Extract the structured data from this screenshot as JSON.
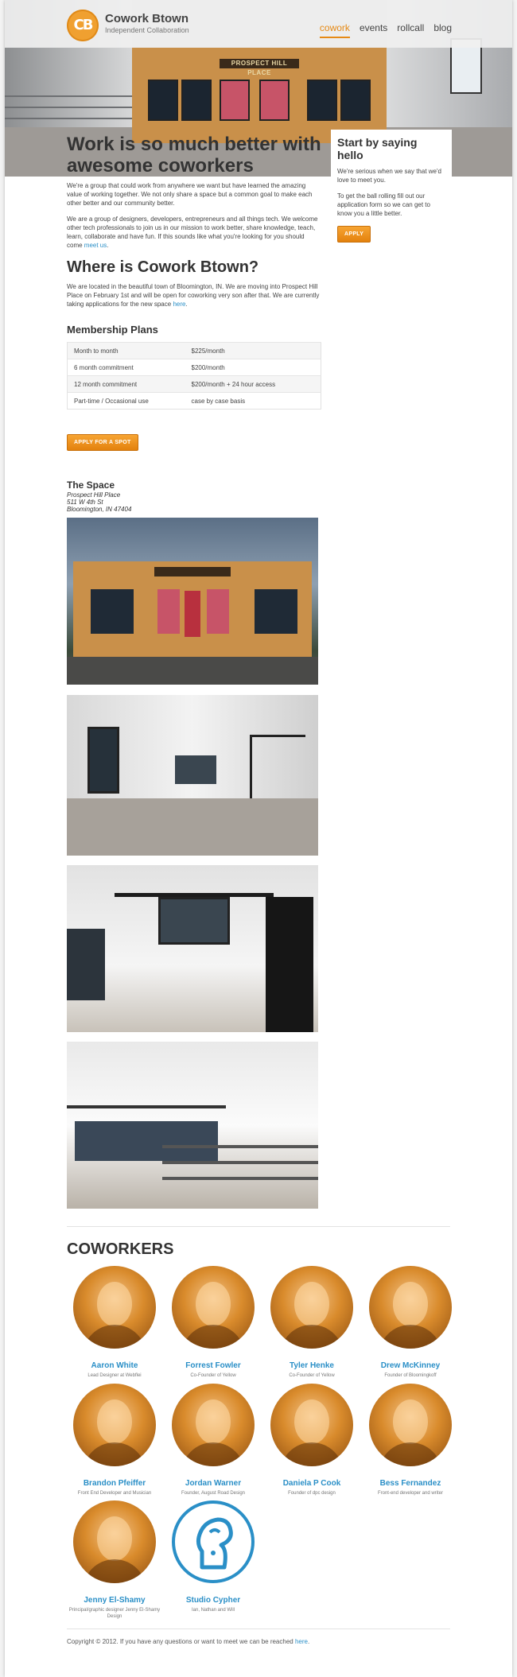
{
  "header": {
    "logo_text": "CB",
    "brand": "Cowork Btown",
    "tagline": "Independent Collaboration",
    "nav": [
      "cowork",
      "events",
      "rollcall",
      "blog"
    ]
  },
  "hero": {
    "sign": "PROSPECT HILL PLACE",
    "heading": "Work is so much better with awesome coworkers"
  },
  "hello": {
    "title": "Start by saying hello",
    "p1": "We're serious when we say that we'd love to meet you.",
    "p2": "To get the ball rolling fill out our application form so we can get to know you a little better.",
    "button": "APPLY"
  },
  "intro": {
    "p1": "We're a group that could work from anywhere we want but have learned the amazing value of working together. We not only share a space but a common goal to make each other better and our community better.",
    "p2": "We are a group of designers, developers, entrepreneurs and all things tech. We welcome other tech professionals to join us in our mission to work better, share knowledge, teach, learn, collaborate and have fun. If this sounds like what you're looking for you should come",
    "p2_link": "meet us",
    "p2_end": "."
  },
  "where": {
    "title": "Where is Cowork Btown?",
    "text": "We are located in the beautiful town of Bloomington, IN. We are moving into Prospect Hill Place on February 1st and will be open for coworking very son after that. We are currently taking applications for the new space",
    "link": "here",
    "end": "."
  },
  "membership": {
    "title": "Membership Plans",
    "rows": [
      [
        "Month to month",
        "$225/month"
      ],
      [
        "6 month commitment",
        "$200/month"
      ],
      [
        "12 month commitment",
        "$200/month + 24 hour access"
      ],
      [
        "Part-time / Occasional use",
        "case by case basis"
      ]
    ],
    "button": "APPLY FOR A SPOT"
  },
  "space": {
    "title": "The Space",
    "line1": "Prospect Hill Place",
    "line2": "511 W 4th St",
    "line3": "Bloomington, IN 47404"
  },
  "coworkers": {
    "title": "COWORKERS",
    "people": [
      {
        "name": "Aaron White",
        "role": "Lead Designer at Webflei"
      },
      {
        "name": "Forrest Fowler",
        "role": "Co-Founder of Yellow"
      },
      {
        "name": "Tyler Henke",
        "role": "Co-Founder of Yellow"
      },
      {
        "name": "Drew McKinney",
        "role": "Founder of Bloomingkoff"
      },
      {
        "name": "Brandon Pfeiffer",
        "role": "Front End Developer and Musician"
      },
      {
        "name": "Jordan Warner",
        "role": "Founder, August Road Design"
      },
      {
        "name": "Daniela P Cook",
        "role": "Founder of dpc design"
      },
      {
        "name": "Bess Fernandez",
        "role": "Front-end developer and writer"
      },
      {
        "name": "Jenny El-Shamy",
        "role": "Principal/graphic designer Jenny El-Shamy Design"
      },
      {
        "name": "Studio Cypher",
        "role": "Ian, Nathan and Will"
      }
    ]
  },
  "footer": {
    "text": "Copyright © 2012.   If you have any questions or want to meet we can be reached",
    "link": "here",
    "end": "."
  }
}
